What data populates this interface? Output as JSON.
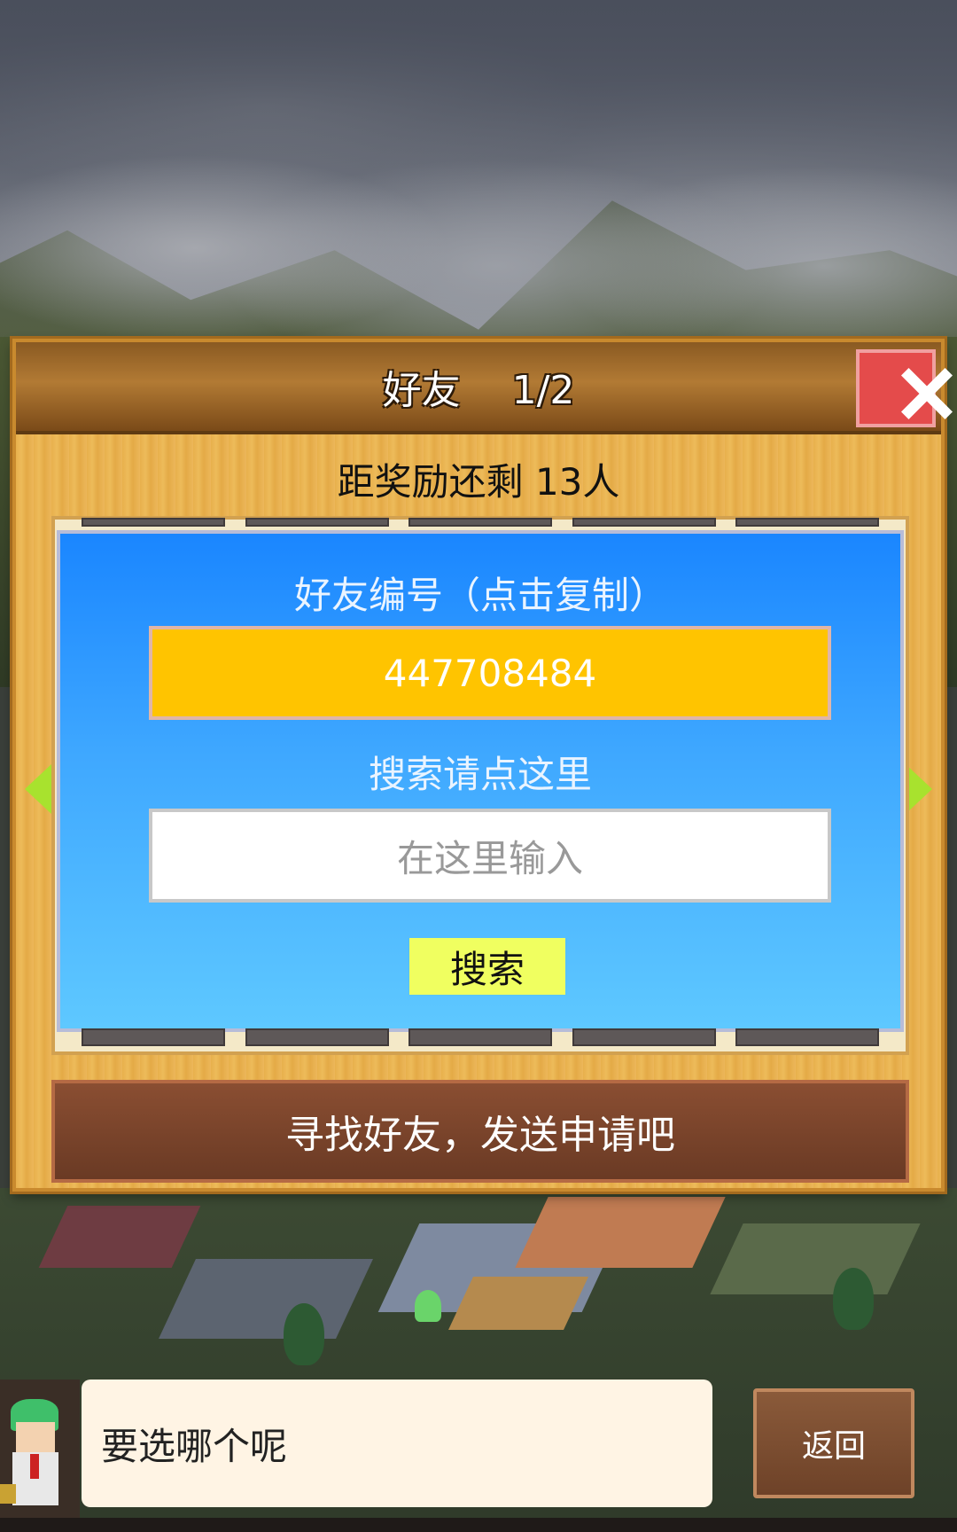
{
  "dialog": {
    "title": "好友　 1/2",
    "reward_text": "距奖励还剩 13人",
    "friend_id_label": "好友编号（点击复制）",
    "friend_id": "447708484",
    "search_label": "搜索请点这里",
    "search_placeholder": "在这里输入",
    "search_button": "搜索",
    "find_friends_button": "寻找好友，发送申请吧"
  },
  "bottom_bar": {
    "speech_text": "要选哪个呢",
    "back_button": "返回"
  },
  "colors": {
    "panel_blue": "#1a86ff",
    "friend_id_bg": "#ffc400",
    "search_button_bg": "#f0ff60",
    "close_red": "#e44b4b",
    "arrow_green": "#a8e22e"
  },
  "icons": {
    "close": "close-icon",
    "prev": "arrow-left-icon",
    "next": "arrow-right-icon"
  }
}
